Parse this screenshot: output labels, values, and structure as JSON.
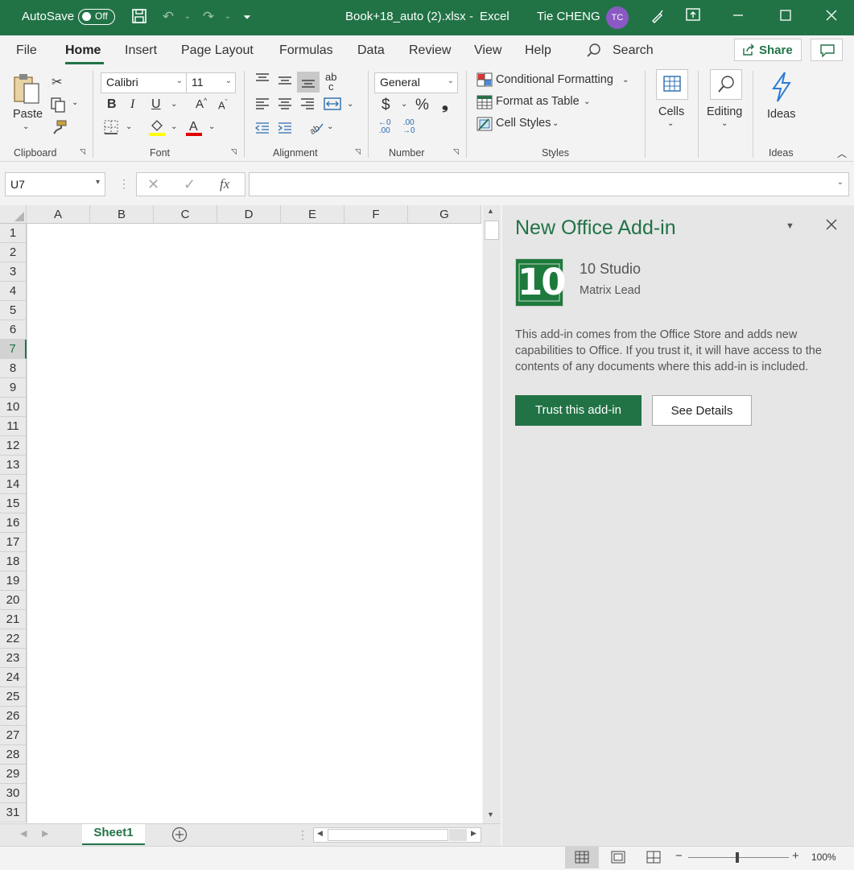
{
  "titlebar": {
    "autosave_label": "AutoSave",
    "autosave_state": "Off",
    "doc_title": "Book+18_auto (2).xlsx",
    "separator": "-",
    "app_name": "Excel",
    "user_name": "Tie CHENG",
    "user_initials": "TC"
  },
  "tabs": {
    "file": "File",
    "home": "Home",
    "insert": "Insert",
    "page_layout": "Page Layout",
    "formulas": "Formulas",
    "data": "Data",
    "review": "Review",
    "view": "View",
    "help": "Help",
    "search": "Search",
    "share": "Share"
  },
  "ribbon": {
    "clipboard": {
      "paste": "Paste",
      "label": "Clipboard"
    },
    "font": {
      "name": "Calibri",
      "size": "11",
      "label": "Font",
      "bold": "B",
      "italic": "I",
      "underline": "U"
    },
    "alignment": {
      "label": "Alignment"
    },
    "number": {
      "format": "General",
      "label": "Number",
      "currency": "$",
      "percent": "%"
    },
    "styles": {
      "conditional": "Conditional Formatting",
      "format_table": "Format as Table",
      "cell_styles": "Cell Styles",
      "label": "Styles"
    },
    "cells": {
      "label": "Cells"
    },
    "editing": {
      "label": "Editing"
    },
    "ideas": {
      "button": "Ideas",
      "label": "Ideas"
    }
  },
  "formula_bar": {
    "name_box": "U7",
    "fx": "fx",
    "value": ""
  },
  "grid": {
    "columns": [
      "A",
      "B",
      "C",
      "D",
      "E",
      "F",
      "G"
    ],
    "rows": [
      "1",
      "2",
      "3",
      "4",
      "5",
      "6",
      "7",
      "8",
      "9",
      "10",
      "11",
      "12",
      "13",
      "14",
      "15",
      "16",
      "17",
      "18",
      "19",
      "20",
      "21",
      "22",
      "23",
      "24",
      "25",
      "26",
      "27",
      "28",
      "29",
      "30",
      "31"
    ],
    "selected_row": "7"
  },
  "sheets": {
    "active": "Sheet1"
  },
  "status": {
    "zoom": "100%"
  },
  "pane": {
    "title": "New Office Add-in",
    "addin_name": "10 Studio",
    "publisher": "Matrix Lead",
    "description": "This add-in comes from the Office Store and adds new capabilities to Office. If you trust it, it will have access to the contents of any documents where this add-in is included.",
    "trust_button": "Trust this add-in",
    "details_button": "See Details",
    "logo_text": "10"
  },
  "colors": {
    "accent": "#217346",
    "avatar": "#8a59c4",
    "highlight": "#ffff00",
    "font_color": "#e00000",
    "ideas": "#2b7cd3"
  }
}
